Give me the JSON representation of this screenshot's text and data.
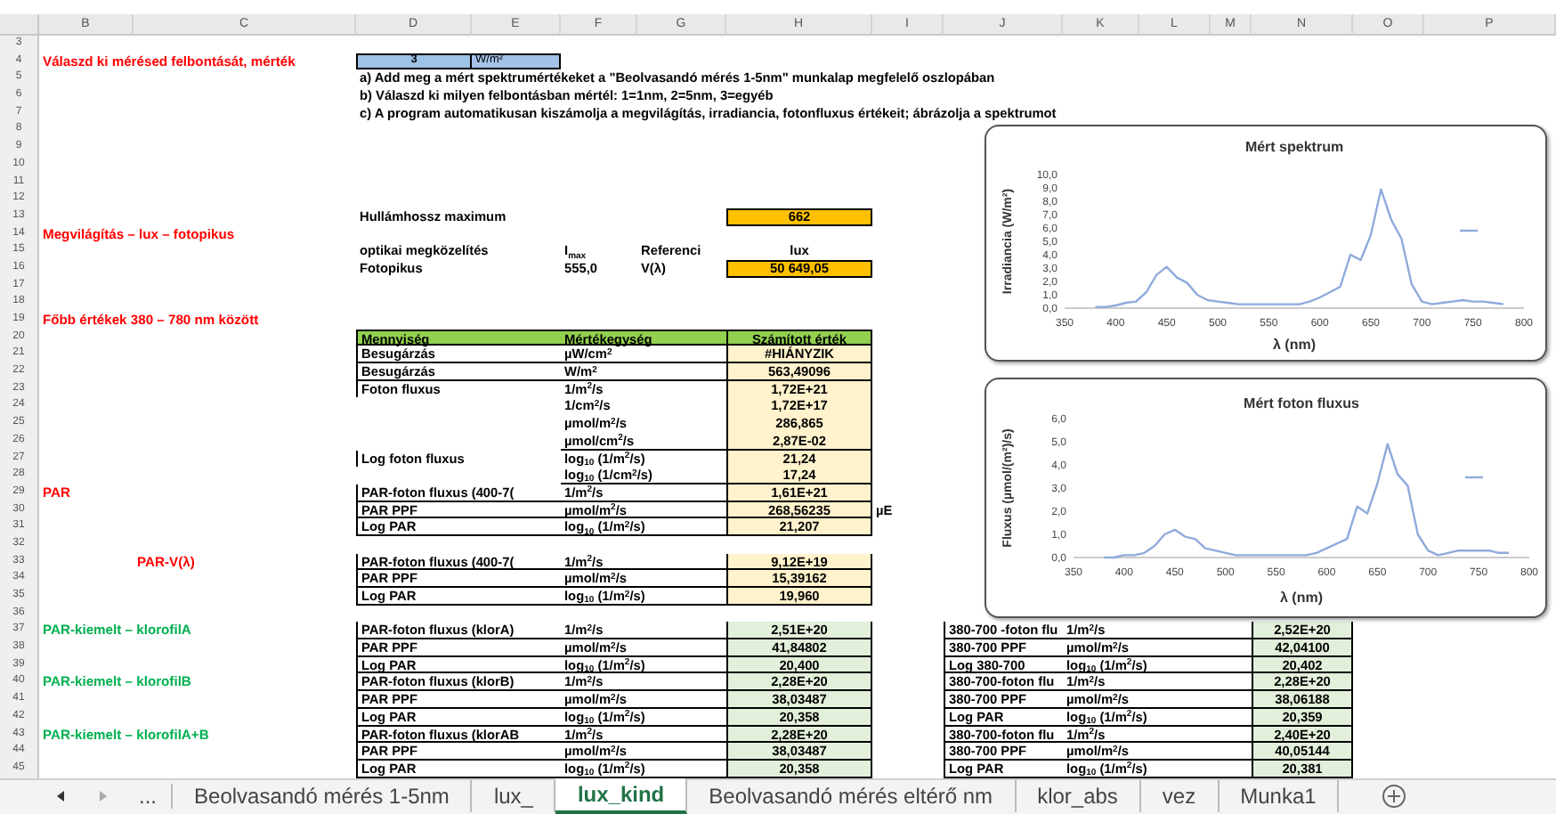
{
  "sheet": {
    "columns": [
      "B",
      "C",
      "D",
      "E",
      "F",
      "G",
      "H",
      "I",
      "J",
      "K",
      "L",
      "M",
      "N",
      "O",
      "P"
    ],
    "rows": [
      {
        "number": "3"
      },
      {
        "number": "4",
        "col_b": {
          "text": "Válaszd ki mérésed felbontását, mérték",
          "kind": "red-title"
        },
        "col_d": {
          "text": "3",
          "kind": "input-value"
        },
        "col_e": {
          "text": "W/m²",
          "kind": "input-unit"
        }
      },
      {
        "number": "5",
        "col_d": {
          "text": "a) Add meg a mért spektrumértékeket a \"Beolvasandó mérés 1-5nm\" munkalap megfelelő oszlopában",
          "kind": "note"
        }
      },
      {
        "number": "6",
        "col_d": {
          "text": "b) Válaszd ki milyen felbontásban mértél: 1=1nm, 2=5nm, 3=egyéb",
          "kind": "note"
        }
      },
      {
        "number": "7",
        "col_d": {
          "text": "c) A program automatikusan kiszámolja a megvilágítás, irradiancia, fotonfluxus értékeit; ábrázolja a spektrumot",
          "kind": "note"
        }
      },
      {
        "number": "8"
      },
      {
        "number": "9"
      },
      {
        "number": "10"
      },
      {
        "number": "11"
      },
      {
        "number": "12"
      },
      {
        "number": "13",
        "col_d": {
          "text": "Hullámhossz maximum",
          "kind": "note"
        },
        "col_h": {
          "text": "662",
          "kind": "orange-value"
        }
      },
      {
        "number": "14",
        "col_b": {
          "text": "Megvilágítás – lux – fotopikus",
          "kind": "red-title"
        }
      },
      {
        "number": "15",
        "col_d": {
          "text": "optikai megközelítés",
          "kind": "note"
        },
        "col_f": {
          "text": "I$_{max}$",
          "kind": "note"
        },
        "col_g": {
          "text": "Referenci",
          "kind": "note"
        },
        "col_h": {
          "text": "lux",
          "kind": "center-note"
        }
      },
      {
        "number": "16",
        "col_d": {
          "text": "Fotopikus",
          "kind": "note"
        },
        "col_f": {
          "text": "555,0",
          "kind": "note"
        },
        "col_g": {
          "text": "V(λ)",
          "kind": "note"
        },
        "col_h": {
          "text": "50 649,05",
          "kind": "orange-value"
        }
      },
      {
        "number": "17"
      },
      {
        "number": "18"
      },
      {
        "number": "19",
        "col_b": {
          "text": "Főbb értékek 380 – 780 nm között",
          "kind": "red-title"
        }
      },
      {
        "number": "20",
        "col_d": {
          "text": "Mennyiség",
          "kind": "head-name"
        },
        "col_f": {
          "text": "Mértékegység",
          "kind": "head-unit"
        },
        "col_h": {
          "text": "Számított érték",
          "kind": "head-value"
        }
      },
      {
        "number": "21",
        "col_d": {
          "text": "Besugárzás",
          "kind": "name"
        },
        "col_f": {
          "text": "µW/cm$^{2}$",
          "kind": "unit"
        },
        "col_h": {
          "text": "#HIÁNYZIK",
          "kind": "cream-value"
        }
      },
      {
        "number": "22",
        "col_d": {
          "text": "Besugárzás",
          "kind": "name"
        },
        "col_f": {
          "text": "W/m$^{2}$",
          "kind": "unit"
        },
        "col_h": {
          "text": "563,49096",
          "kind": "cream-value"
        }
      },
      {
        "number": "23",
        "col_d": {
          "text": "Foton fluxus",
          "kind": "name-open"
        },
        "col_f": {
          "text": "1/m$^{2}$/s",
          "kind": "unit-open"
        },
        "col_h": {
          "text": "1,72E+21",
          "kind": "cream-value-open"
        }
      },
      {
        "number": "24",
        "col_f": {
          "text": "1/cm$^{2}$/s",
          "kind": "unit-open"
        },
        "col_h": {
          "text": "1,72E+17",
          "kind": "cream-value-open"
        }
      },
      {
        "number": "25",
        "col_f": {
          "text": "µmol/m$^{2}$/s",
          "kind": "unit-open"
        },
        "col_h": {
          "text": "286,865",
          "kind": "cream-value-open"
        }
      },
      {
        "number": "26",
        "col_f": {
          "text": "µmol/cm$^{2}$/s",
          "kind": "unit"
        },
        "col_h": {
          "text": "2,87E-02",
          "kind": "cream-value"
        }
      },
      {
        "number": "27",
        "col_d": {
          "text": "Log foton fluxus",
          "kind": "name-open"
        },
        "col_f": {
          "text": "log$_{10}$ (1/m$^{2}$/s)",
          "kind": "unit-open"
        },
        "col_h": {
          "text": "21,24",
          "kind": "cream-value-open"
        }
      },
      {
        "number": "28",
        "col_f": {
          "text": "log$_{10}$ (1/cm$^{2}$/s)",
          "kind": "unit"
        },
        "col_h": {
          "text": "17,24",
          "kind": "cream-value"
        }
      },
      {
        "number": "29",
        "col_b": {
          "text": "PAR",
          "kind": "red-title"
        },
        "col_d": {
          "text": "PAR-foton fluxus (400-7(",
          "kind": "name"
        },
        "col_f": {
          "text": "1/m$^{2}$/s",
          "kind": "unit"
        },
        "col_h": {
          "text": "1,61E+21",
          "kind": "cream-value"
        }
      },
      {
        "number": "30",
        "col_d": {
          "text": "PAR PPF",
          "kind": "name"
        },
        "col_f": {
          "text": "µmol/m$^{2}$/s",
          "kind": "unit"
        },
        "col_h": {
          "text": "268,56235",
          "kind": "cream-value"
        },
        "col_i": {
          "text": "µE",
          "kind": "side-note"
        }
      },
      {
        "number": "31",
        "col_d": {
          "text": "Log PAR",
          "kind": "name"
        },
        "col_f": {
          "text": "log$_{10}$ (1/m$^{2}$/s)",
          "kind": "unit"
        },
        "col_h": {
          "text": "21,207",
          "kind": "cream-value"
        }
      },
      {
        "number": "32"
      },
      {
        "number": "33",
        "col_c": {
          "text": "PAR-V(λ)",
          "kind": "red-title"
        },
        "col_d": {
          "text": "PAR-foton fluxus (400-7(",
          "kind": "name"
        },
        "col_f": {
          "text": "1/m$^{2}$/s",
          "kind": "unit"
        },
        "col_h": {
          "text": "9,12E+19",
          "kind": "cream-value"
        }
      },
      {
        "number": "34",
        "col_d": {
          "text": "PAR PPF",
          "kind": "name"
        },
        "col_f": {
          "text": "µmol/m$^{2}$/s",
          "kind": "unit"
        },
        "col_h": {
          "text": "15,39162",
          "kind": "cream-value"
        }
      },
      {
        "number": "35",
        "col_d": {
          "text": "Log PAR",
          "kind": "name"
        },
        "col_f": {
          "text": "log$_{10}$ (1/m$^{2}$/s)",
          "kind": "unit"
        },
        "col_h": {
          "text": "19,960",
          "kind": "cream-value"
        }
      },
      {
        "number": "36"
      },
      {
        "number": "37",
        "col_b": {
          "text": "PAR-kiemelt – klorofilA",
          "kind": "green-title"
        },
        "col_d": {
          "text": "PAR-foton fluxus (klorA)",
          "kind": "name"
        },
        "col_f": {
          "text": "1/m$^{2}$/s",
          "kind": "unit"
        },
        "col_h": {
          "text": "2,51E+20",
          "kind": "green-value"
        },
        "col_j": {
          "text": "380-700 -foton flu",
          "kind": "name"
        },
        "col_k": {
          "text": "1/m$^{2}$/s",
          "kind": "unit"
        },
        "col_n": {
          "text": "2,52E+20",
          "kind": "green-value"
        }
      },
      {
        "number": "38",
        "col_d": {
          "text": "PAR PPF",
          "kind": "name"
        },
        "col_f": {
          "text": "µmol/m$^{2}$/s",
          "kind": "unit"
        },
        "col_h": {
          "text": "41,84802",
          "kind": "green-value"
        },
        "col_j": {
          "text": "380-700 PPF",
          "kind": "name"
        },
        "col_k": {
          "text": "µmol/m$^{2}$/s",
          "kind": "unit"
        },
        "col_n": {
          "text": "42,04100",
          "kind": "green-value"
        }
      },
      {
        "number": "39",
        "col_d": {
          "text": "Log PAR",
          "kind": "name"
        },
        "col_f": {
          "text": "log$_{10}$ (1/m$^{2}$/s)",
          "kind": "unit"
        },
        "col_h": {
          "text": "20,400",
          "kind": "green-value"
        },
        "col_j": {
          "text": "Log 380-700",
          "kind": "name"
        },
        "col_k": {
          "text": "log$_{10}$ (1/m$^{2}$/s)",
          "kind": "unit"
        },
        "col_n": {
          "text": "20,402",
          "kind": "green-value"
        }
      },
      {
        "number": "40",
        "col_b": {
          "text": "PAR-kiemelt – klorofilB",
          "kind": "green-title"
        },
        "col_d": {
          "text": "PAR-foton fluxus (klorB)",
          "kind": "name"
        },
        "col_f": {
          "text": "1/m$^{2}$/s",
          "kind": "unit"
        },
        "col_h": {
          "text": "2,28E+20",
          "kind": "green-value"
        },
        "col_j": {
          "text": "380-700-foton flu",
          "kind": "name"
        },
        "col_k": {
          "text": "1/m$^{2}$/s",
          "kind": "unit"
        },
        "col_n": {
          "text": "2,28E+20",
          "kind": "green-value"
        }
      },
      {
        "number": "41",
        "col_d": {
          "text": "PAR PPF",
          "kind": "name"
        },
        "col_f": {
          "text": "µmol/m$^{2}$/s",
          "kind": "unit"
        },
        "col_h": {
          "text": "38,03487",
          "kind": "green-value"
        },
        "col_j": {
          "text": "380-700 PPF",
          "kind": "name"
        },
        "col_k": {
          "text": "µmol/m$^{2}$/s",
          "kind": "unit"
        },
        "col_n": {
          "text": "38,06188",
          "kind": "green-value"
        }
      },
      {
        "number": "42",
        "col_d": {
          "text": "Log PAR",
          "kind": "name"
        },
        "col_f": {
          "text": "log$_{10}$ (1/m$^{2}$/s)",
          "kind": "unit"
        },
        "col_h": {
          "text": "20,358",
          "kind": "green-value"
        },
        "col_j": {
          "text": "Log PAR",
          "kind": "name"
        },
        "col_k": {
          "text": "log$_{10}$ (1/m$^{2}$/s)",
          "kind": "unit"
        },
        "col_n": {
          "text": "20,359",
          "kind": "green-value"
        }
      },
      {
        "number": "43",
        "col_b": {
          "text": "PAR-kiemelt – klorofilA+B",
          "kind": "green-title"
        },
        "col_d": {
          "text": "PAR-foton fluxus (klorAB",
          "kind": "name"
        },
        "col_f": {
          "text": "1/m$^{2}$/s",
          "kind": "unit"
        },
        "col_h": {
          "text": "2,28E+20",
          "kind": "green-value"
        },
        "col_j": {
          "text": "380-700-foton flu",
          "kind": "name"
        },
        "col_k": {
          "text": "1/m$^{2}$/s",
          "kind": "unit"
        },
        "col_n": {
          "text": "2,40E+20",
          "kind": "green-value"
        }
      },
      {
        "number": "44",
        "col_d": {
          "text": "PAR PPF",
          "kind": "name"
        },
        "col_f": {
          "text": "µmol/m$^{2}$/s",
          "kind": "unit"
        },
        "col_h": {
          "text": "38,03487",
          "kind": "green-value"
        },
        "col_j": {
          "text": "380-700 PPF",
          "kind": "name"
        },
        "col_k": {
          "text": "µmol/m$^{2}$/s",
          "kind": "unit"
        },
        "col_n": {
          "text": "40,05144",
          "kind": "green-value"
        }
      },
      {
        "number": "45",
        "col_d": {
          "text": "Log PAR",
          "kind": "name"
        },
        "col_f": {
          "text": "log$_{10}$ (1/m$^{2}$/s)",
          "kind": "unit"
        },
        "col_h": {
          "text": "20,358",
          "kind": "green-value"
        },
        "col_j": {
          "text": "Log PAR",
          "kind": "name"
        },
        "col_k": {
          "text": "log$_{10}$ (1/m$^{2}$/s)",
          "kind": "unit"
        },
        "col_n": {
          "text": "20,381",
          "kind": "green-value"
        }
      }
    ]
  },
  "charts": [
    {
      "chart_data": {
        "type": "line",
        "title": "Mért spektrum",
        "xlabel": "λ (nm)",
        "ylabel": "Irradiancia (W/m²)",
        "x": [
          380,
          390,
          400,
          410,
          420,
          430,
          440,
          450,
          460,
          470,
          480,
          490,
          500,
          510,
          520,
          530,
          540,
          550,
          560,
          570,
          580,
          590,
          600,
          610,
          620,
          630,
          640,
          650,
          660,
          670,
          680,
          690,
          700,
          710,
          720,
          730,
          740,
          750,
          760,
          770,
          780
        ],
        "series": [
          {
            "color": "#8faadc",
            "values": [
              0.1,
              0.1,
              0.2,
              0.4,
              0.5,
              1.2,
              2.5,
              3.1,
              2.3,
              1.9,
              1.0,
              0.6,
              0.5,
              0.4,
              0.3,
              0.3,
              0.3,
              0.3,
              0.3,
              0.3,
              0.3,
              0.5,
              0.8,
              1.2,
              1.6,
              4.0,
              3.6,
              5.5,
              8.9,
              6.6,
              5.2,
              1.8,
              0.5,
              0.3,
              0.4,
              0.5,
              0.6,
              0.5,
              0.5,
              0.4,
              0.3
            ]
          }
        ],
        "xlim": [
          350,
          800
        ],
        "ylim": [
          0,
          10
        ],
        "xticks": [
          350,
          400,
          450,
          500,
          550,
          600,
          650,
          700,
          750,
          800
        ],
        "yticks": [
          {
            "value": 0,
            "label": "0,0"
          },
          {
            "value": 1,
            "label": "1,0"
          },
          {
            "value": 2,
            "label": "2,0"
          },
          {
            "value": 3,
            "label": "3,0"
          },
          {
            "value": 4,
            "label": "4,0"
          },
          {
            "value": 5,
            "label": "5,0"
          },
          {
            "value": 6,
            "label": "6,0"
          },
          {
            "value": 7,
            "label": "7,0"
          },
          {
            "value": 8,
            "label": "8,0"
          },
          {
            "value": 9,
            "label": "9,0"
          },
          {
            "value": 10,
            "label": "10,0"
          }
        ]
      }
    },
    {
      "chart_data": {
        "type": "line",
        "title": "Mért foton fluxus",
        "xlabel": "λ (nm)",
        "ylabel": "Fluxus (µmol/(m²)/s)",
        "x": [
          380,
          390,
          400,
          410,
          420,
          430,
          440,
          450,
          460,
          470,
          480,
          490,
          500,
          510,
          520,
          530,
          540,
          550,
          560,
          570,
          580,
          590,
          600,
          610,
          620,
          630,
          640,
          650,
          660,
          670,
          680,
          690,
          700,
          710,
          720,
          730,
          740,
          750,
          760,
          770,
          780
        ],
        "series": [
          {
            "color": "#8faadc",
            "values": [
              0.0,
              0.0,
              0.1,
              0.1,
              0.2,
              0.5,
              1.0,
              1.2,
              0.9,
              0.8,
              0.4,
              0.3,
              0.2,
              0.1,
              0.1,
              0.1,
              0.1,
              0.1,
              0.1,
              0.1,
              0.1,
              0.2,
              0.4,
              0.6,
              0.8,
              2.2,
              1.9,
              3.2,
              4.9,
              3.6,
              3.1,
              1.0,
              0.3,
              0.1,
              0.2,
              0.3,
              0.3,
              0.3,
              0.3,
              0.2,
              0.2
            ]
          }
        ],
        "xlim": [
          350,
          800
        ],
        "ylim": [
          0,
          6
        ],
        "xticks": [
          350,
          400,
          450,
          500,
          550,
          600,
          650,
          700,
          750,
          800
        ],
        "yticks": [
          {
            "value": 0,
            "label": "0,0"
          },
          {
            "value": 1,
            "label": "1,0"
          },
          {
            "value": 2,
            "label": "2,0"
          },
          {
            "value": 3,
            "label": "3,0"
          },
          {
            "value": 4,
            "label": "4,0"
          },
          {
            "value": 5,
            "label": "5,0"
          },
          {
            "value": 6,
            "label": "6,0"
          }
        ]
      }
    }
  ],
  "sheet_tabs": {
    "more": "...",
    "tabs": [
      {
        "label": "Beolvasandó mérés 1-5nm",
        "selected": false
      },
      {
        "label": "lux_",
        "selected": false
      },
      {
        "label": "lux_kind",
        "selected": true
      },
      {
        "label": "Beolvasandó mérés eltérő nm",
        "selected": false
      },
      {
        "label": "klor_abs",
        "selected": false
      },
      {
        "label": "vez",
        "selected": false
      },
      {
        "label": "Munka1",
        "selected": false
      }
    ]
  }
}
